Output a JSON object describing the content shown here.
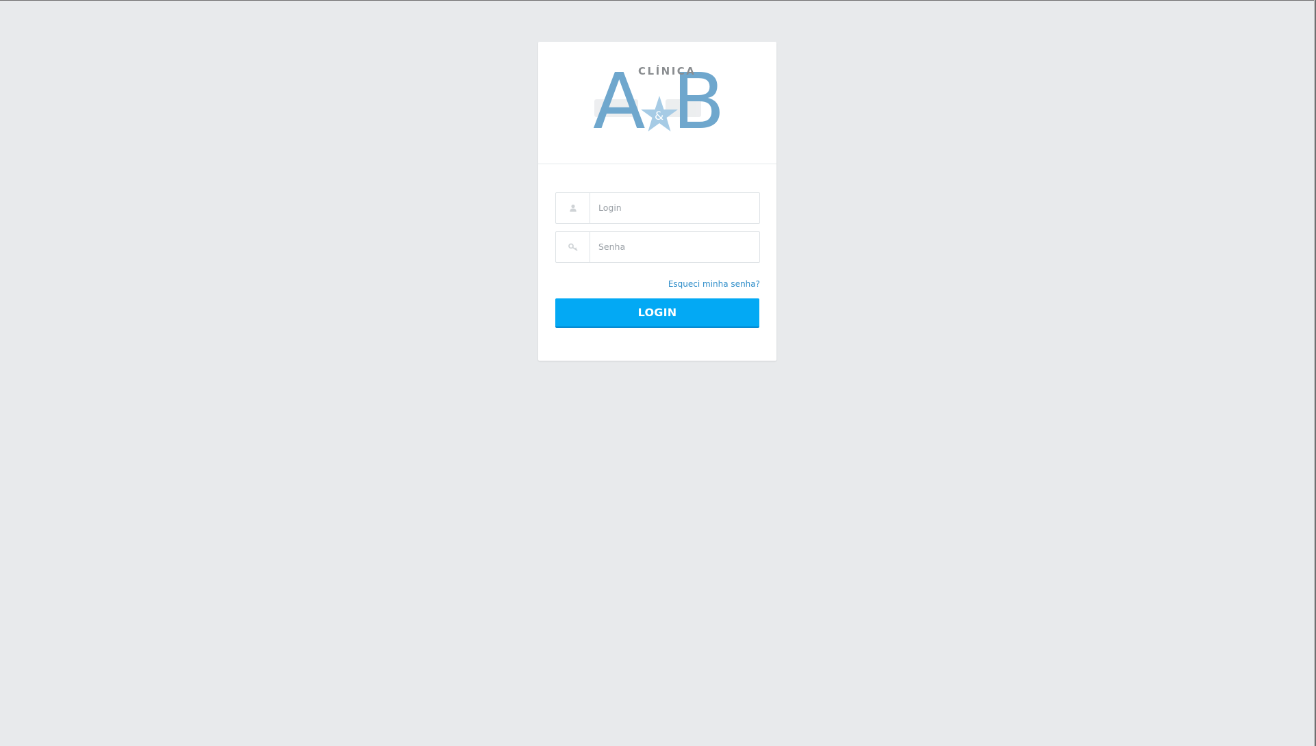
{
  "logo": {
    "letter_a": "A",
    "letter_b": "B",
    "clinica": "CLÍNICA",
    "ampersand": "&",
    "color_main": "#6fa7cd",
    "color_star": "#a6cbe5",
    "color_text": "#8a8d90"
  },
  "form": {
    "login_placeholder": "Login",
    "login_icon": "user-icon",
    "password_placeholder": "Senha",
    "password_icon": "key-icon",
    "forgot_label": "Esqueci minha senha?",
    "submit_label": "LOGIN"
  },
  "colors": {
    "background": "#e8eaec",
    "accent": "#03a9f4",
    "link": "#2e8dc9"
  }
}
